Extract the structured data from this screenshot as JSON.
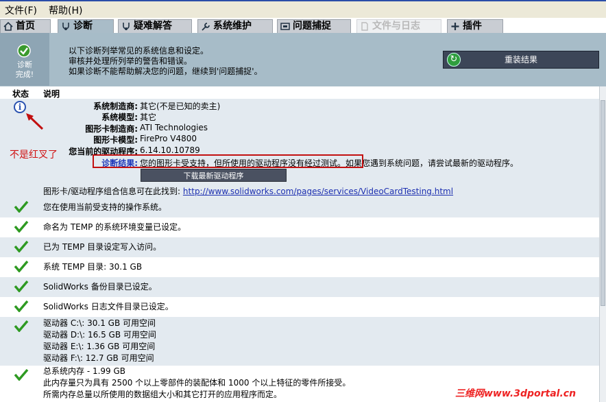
{
  "menu": {
    "file": "文件(F)",
    "help": "帮助(H)"
  },
  "tabs": [
    {
      "label": "首页",
      "icon": "home-icon"
    },
    {
      "label": "诊断",
      "icon": "stethoscope-icon"
    },
    {
      "label": "疑难解答",
      "icon": "stethoscope-icon"
    },
    {
      "label": "系统维护",
      "icon": "wrench-icon"
    },
    {
      "label": "问题捕捉",
      "icon": "capture-icon"
    },
    {
      "label": "文件与日志",
      "icon": "document-icon"
    },
    {
      "label": "插件",
      "icon": "plus-icon"
    }
  ],
  "header": {
    "status_label_1": "诊断",
    "status_label_2": "完成!",
    "intro_1": "以下诊断列举常见的系统信息和设定。",
    "intro_2": "审核并处理所列举的警告和错误。",
    "intro_3": "如果诊断不能帮助解决您的问题，继续到'问题捕捉'。",
    "reset_button": "重装结果"
  },
  "columns": {
    "status": "状态",
    "description": "说明"
  },
  "annotation": "不是红叉了",
  "gpu": {
    "fields": [
      {
        "key": "系统制造商:",
        "value": "其它(不是已知的卖主)"
      },
      {
        "key": "系统模型:",
        "value": "其它"
      },
      {
        "key": "图形卡制造商:",
        "value": "ATI Technologies"
      },
      {
        "key": "图形卡模型:",
        "value": "FirePro V4800"
      },
      {
        "key": "您当前的驱动程序:",
        "value": "6.14.10.10789"
      },
      {
        "key": "诊断结果:",
        "value": "您的图形卡受支持，但所使用的驱动程序没有经过测试。如果您遇到系统问题，请尝试最新的驱动程序。"
      }
    ],
    "download_button": "下载最新驱动程序",
    "link_prefix": "图形卡/驱动程序组合信息可在此找到:",
    "link_url": "http://www.solidworks.com/pages/services/VideoCardTesting.html"
  },
  "checks": [
    {
      "lines": [
        "您在使用当前受支持的操作系统。"
      ]
    },
    {
      "lines": [
        "命名为 TEMP 的系统环境变量已设定。"
      ]
    },
    {
      "lines": [
        "已为 TEMP 目录设定写入访问。"
      ]
    },
    {
      "lines": [
        "系统 TEMP 目录: 30.1 GB"
      ]
    },
    {
      "lines": [
        "SolidWorks 备份目录已设定。"
      ]
    },
    {
      "lines": [
        "SolidWorks 日志文件目录已设定。"
      ]
    },
    {
      "lines": [
        "驱动器 C:\\: 30.1 GB 可用空间",
        "驱动器 D:\\: 16.5 GB 可用空间",
        "驱动器 E:\\: 1.36 GB 可用空间",
        "驱动器 F:\\: 12.7 GB 可用空间"
      ]
    },
    {
      "lines": [
        "总系统内存 - 1.99 GB",
        "此内存量只为具有 2500 个以上零部件的装配体和 1000 个以上特征的零件所接受。",
        "所需内存总量以所使用的数据组大小和其它打开的应用程序而定。"
      ]
    }
  ],
  "watermark": "三维网www.3dportal.cn",
  "colors": {
    "header_bg": "#a7bcc8",
    "alt_row": "#e3eaf0",
    "check_green": "#2e9a22",
    "annotation_red": "#d01010"
  }
}
